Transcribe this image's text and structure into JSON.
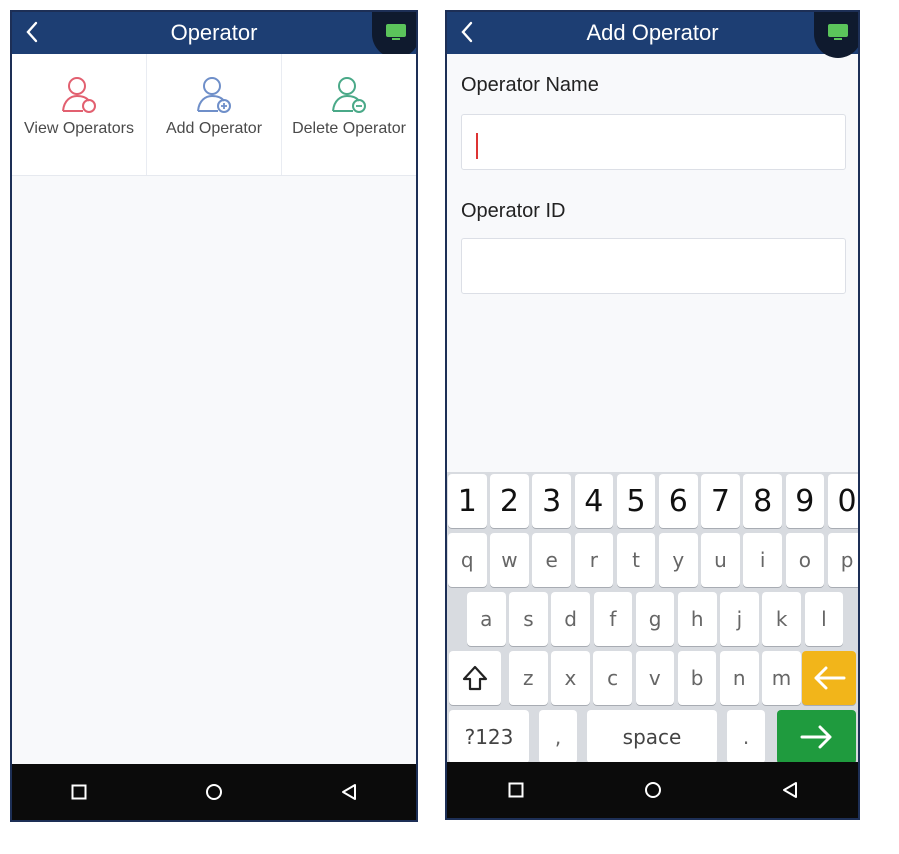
{
  "left_screen": {
    "title": "Operator",
    "menu": [
      {
        "label": "View Operators",
        "icon": "user-view-icon",
        "color": "#e26070"
      },
      {
        "label": "Add Operator",
        "icon": "user-add-icon",
        "color": "#6f8fc9"
      },
      {
        "label": "Delete Operator",
        "icon": "user-delete-icon",
        "color": "#4aa988"
      }
    ]
  },
  "right_screen": {
    "title": "Add Operator",
    "fields": [
      {
        "label": "Operator Name",
        "value": ""
      },
      {
        "label": "Operator ID",
        "value": ""
      }
    ],
    "keyboard": {
      "row_numbers": [
        "1",
        "2",
        "3",
        "4",
        "5",
        "6",
        "7",
        "8",
        "9",
        "0"
      ],
      "row_q": [
        "q",
        "w",
        "e",
        "r",
        "t",
        "y",
        "u",
        "i",
        "o",
        "p"
      ],
      "row_a": [
        "a",
        "s",
        "d",
        "f",
        "g",
        "h",
        "j",
        "k",
        "l"
      ],
      "row_z": [
        "z",
        "x",
        "c",
        "v",
        "b",
        "n",
        "m"
      ],
      "symbols_label": "?123",
      "comma": ",",
      "space_label": "space",
      "period": "."
    }
  },
  "colors": {
    "header": "#1d3e73",
    "enter_key": "#1f9b3e",
    "backspace_key": "#f2b51a"
  }
}
